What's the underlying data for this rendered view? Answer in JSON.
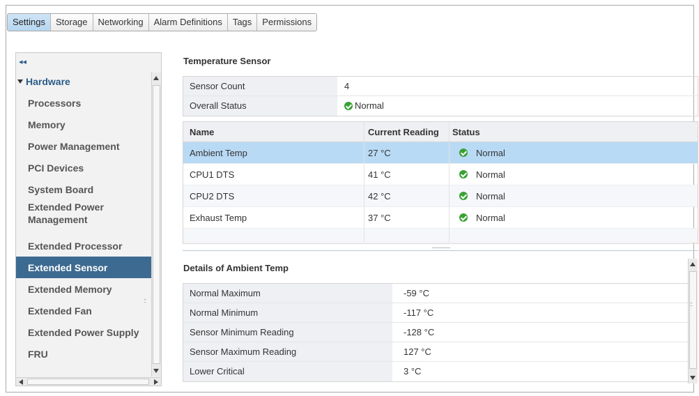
{
  "tabs": [
    {
      "label": "Settings"
    },
    {
      "label": "Storage"
    },
    {
      "label": "Networking"
    },
    {
      "label": "Alarm Definitions"
    },
    {
      "label": "Tags"
    },
    {
      "label": "Permissions"
    }
  ],
  "sidebar": {
    "collapse_label": "◂◂",
    "header": "Hardware",
    "items": [
      {
        "label": "Processors"
      },
      {
        "label": "Memory"
      },
      {
        "label": "Power Management"
      },
      {
        "label": "PCI Devices"
      },
      {
        "label": "System Board"
      },
      {
        "label": "Extended Power Management"
      },
      {
        "label": "Extended Processor"
      },
      {
        "label": "Extended Sensor"
      },
      {
        "label": "Extended Memory"
      },
      {
        "label": "Extended Fan"
      },
      {
        "label": "Extended Power Supply"
      },
      {
        "label": "FRU"
      }
    ]
  },
  "sensor": {
    "title": "Temperature Sensor",
    "summary": [
      {
        "key": "Sensor Count",
        "value": "4"
      },
      {
        "key": "Overall Status",
        "value": "Normal"
      }
    ],
    "columns": [
      "Name",
      "Current Reading",
      "Status"
    ],
    "rows": [
      {
        "name": "Ambient Temp",
        "reading": "27 °C",
        "status": "Normal"
      },
      {
        "name": "CPU1 DTS",
        "reading": "41 °C",
        "status": "Normal"
      },
      {
        "name": "CPU2 DTS",
        "reading": "42 °C",
        "status": "Normal"
      },
      {
        "name": "Exhaust Temp",
        "reading": "37 °C",
        "status": "Normal"
      }
    ]
  },
  "details": {
    "title": "Details of Ambient Temp",
    "rows": [
      {
        "key": "Normal Maximum",
        "value": "-59 °C"
      },
      {
        "key": "Normal Minimum",
        "value": "-117 °C"
      },
      {
        "key": "Sensor Minimum Reading",
        "value": "-128 °C"
      },
      {
        "key": "Sensor Maximum Reading",
        "value": "127 °C"
      },
      {
        "key": "Lower Critical",
        "value": "3 °C"
      }
    ]
  },
  "colors": {
    "accent": "#3d6a91",
    "selected_row": "#b9daf5",
    "ok_green": "#3aa135"
  }
}
